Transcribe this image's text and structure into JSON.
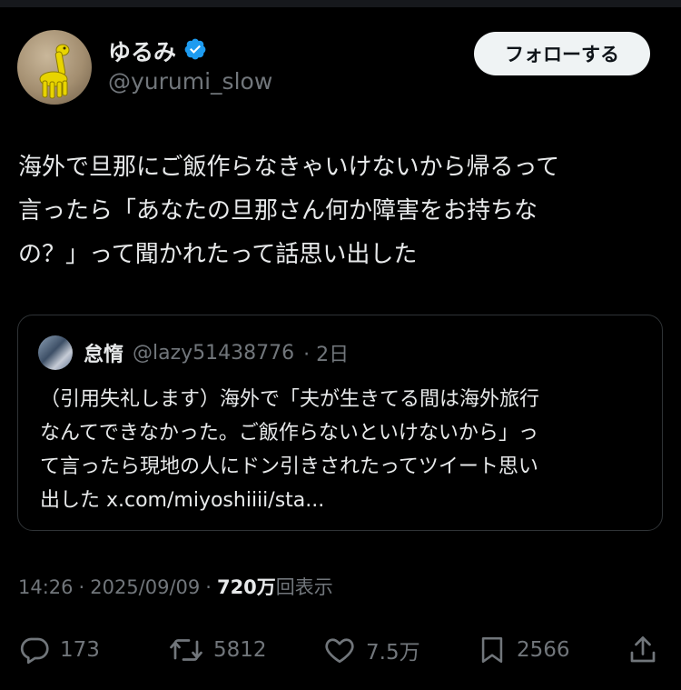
{
  "author": {
    "display_name": "ゆるみ",
    "handle": "@yurumi_slow",
    "verified": true,
    "verified_color": "#1d9bf0"
  },
  "follow_button": {
    "label": "フォローする"
  },
  "tweet": {
    "lines": [
      "海外で旦那にご飯作らなきゃいけないから帰るって",
      "言ったら「あなたの旦那さん何か障害をお持ちな",
      "の？」って聞かれたって話思い出した"
    ]
  },
  "quote": {
    "display_name": "怠惰",
    "handle": "@lazy51438776",
    "time": "· 2日",
    "lines": [
      "（引用失礼します）海外で「夫が生きてる間は海外旅行",
      "なんてできなかった。ご飯作らないといけないから」っ",
      "て言ったら現地の人にドン引きされたってツイート思い",
      "出した x.com/miyoshiiii/sta..."
    ]
  },
  "meta": {
    "time": "14:26",
    "sep1": "·",
    "date": "2025/09/09",
    "sep2": "·",
    "views_count": "720万",
    "views_label": "回表示"
  },
  "actions": {
    "replies": "173",
    "reposts": "5812",
    "likes": "7.5万",
    "bookmarks": "2566"
  },
  "icons": {
    "reply": "reply-icon",
    "repost": "repost-icon",
    "like": "heart-icon",
    "bookmark": "bookmark-icon",
    "share": "share-icon",
    "verified": "verified-badge-icon"
  },
  "colors": {
    "background": "#000000",
    "text_primary": "#e7e9ea",
    "text_secondary": "#71767b",
    "border": "#2f3336",
    "follow_bg": "#eff3f4"
  }
}
